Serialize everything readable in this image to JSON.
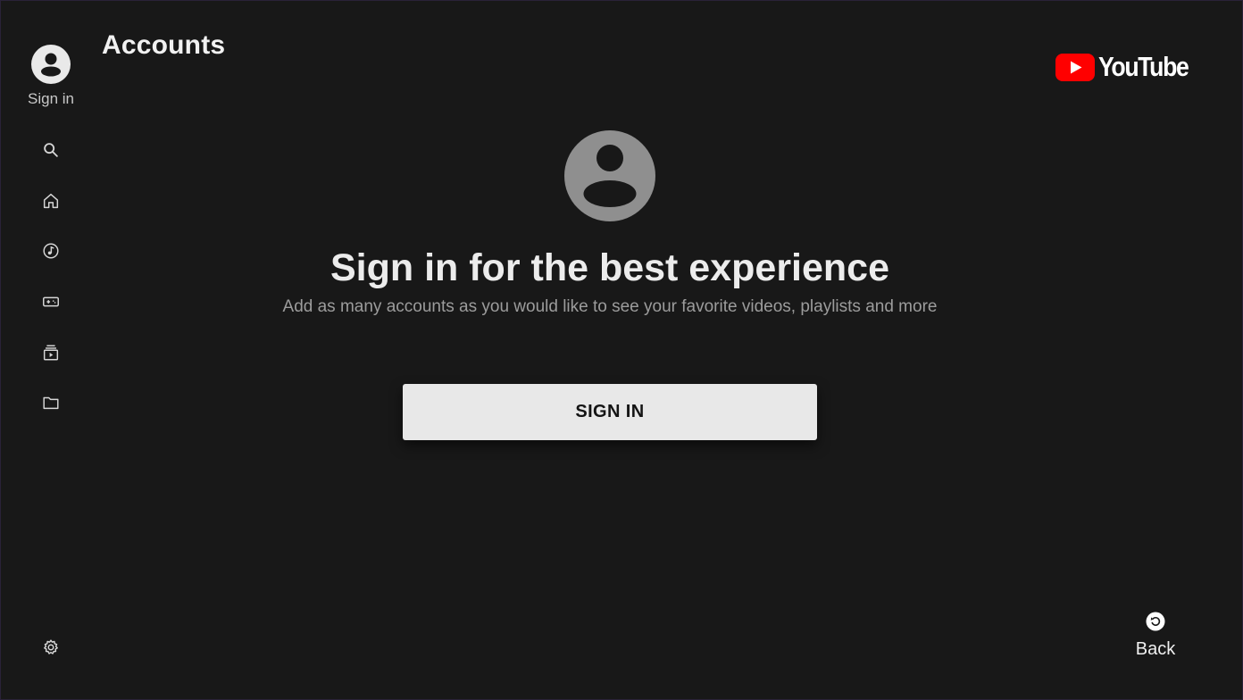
{
  "header": {
    "title": "Accounts",
    "logo_text": "YouTube",
    "logo_color": "#ff0000"
  },
  "sidebar": {
    "profile_label": "Sign in",
    "items": [
      {
        "icon": "search-icon"
      },
      {
        "icon": "home-icon"
      },
      {
        "icon": "music-icon"
      },
      {
        "icon": "gaming-icon"
      },
      {
        "icon": "subscriptions-icon"
      },
      {
        "icon": "library-folder-icon"
      }
    ],
    "settings_icon": "gear-icon"
  },
  "main": {
    "avatar_icon": "account-circle-icon",
    "title": "Sign in for the best experience",
    "subtitle": "Add as many accounts as you would like to see your favorite videos, playlists and more",
    "signin_button": "SIGN IN"
  },
  "footer": {
    "back_label": "Back",
    "back_icon": "back-arrow-icon"
  },
  "colors": {
    "background": "#181818",
    "button_bg": "#e8e8e8",
    "accent": "#ff0000"
  }
}
